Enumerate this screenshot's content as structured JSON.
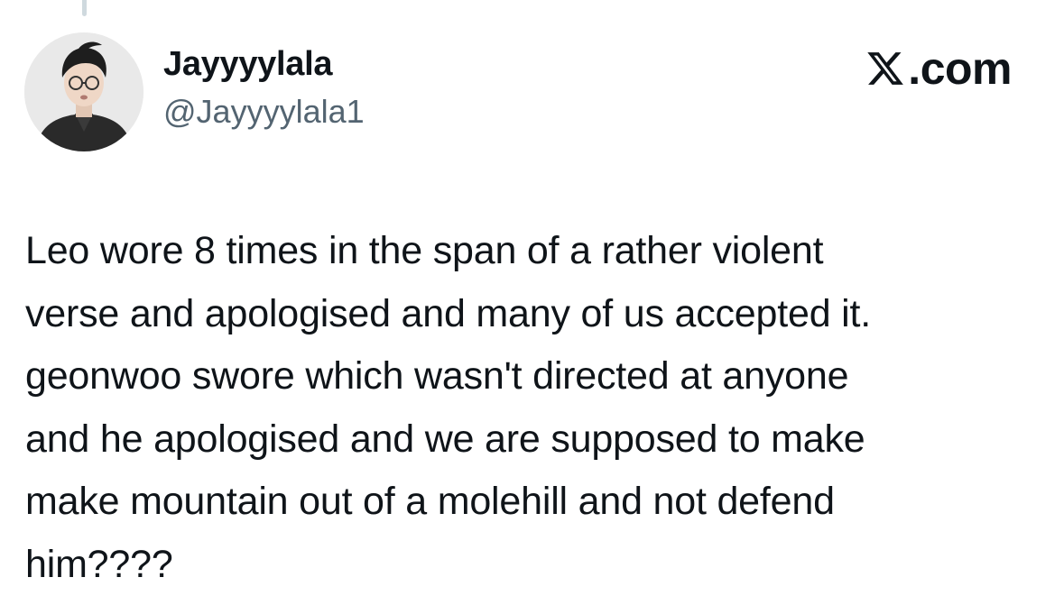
{
  "author": {
    "display_name": "Jayyyylala",
    "handle": "@Jayyyylala1",
    "avatar_icon": "profile-photo"
  },
  "brand": {
    "logo_icon": "x-logo-icon",
    "label": ".com"
  },
  "tweet": {
    "text": "Leo wore 8 times in the span of a rather violent\nverse and apologised and many of us accepted it.\ngeonwoo swore which wasn't directed at anyone\nand he apologised and we are supposed to make\nmake mountain out of a molehill and not defend\nhim????"
  },
  "colors": {
    "text_primary": "#0f1419",
    "text_secondary": "#536471",
    "thread_line": "#cfd9de",
    "background": "#ffffff"
  }
}
